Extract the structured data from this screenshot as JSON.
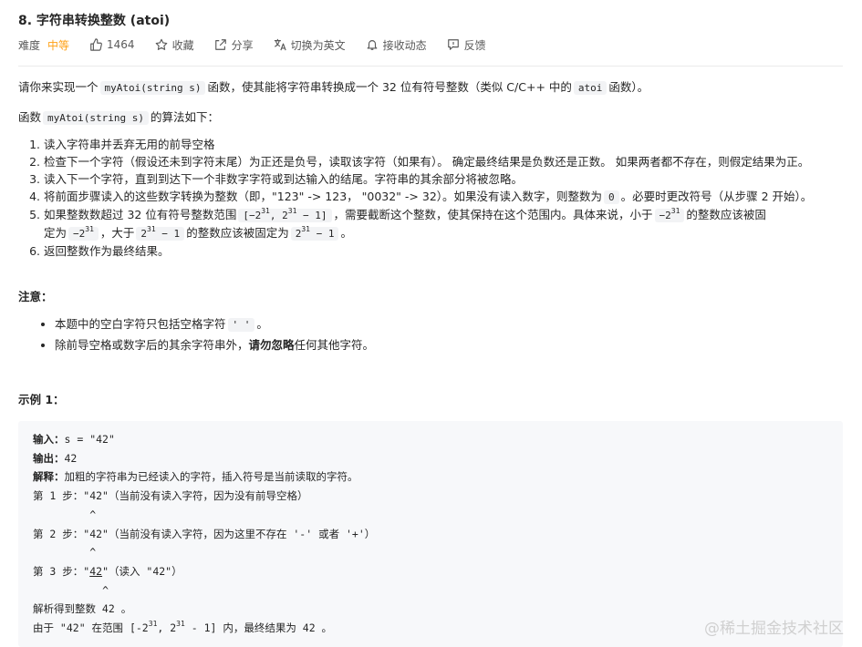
{
  "problem": {
    "title": "8. 字符串转换整数 (atoi)",
    "difficulty_label": "难度",
    "difficulty_value": "中等",
    "like_count": "1464",
    "favorite_label": "收藏",
    "share_label": "分享",
    "translate_label": "切换为英文",
    "subscribe_label": "接收动态",
    "feedback_label": "反馈"
  },
  "intro": {
    "p1_a": "请你来实现一个",
    "p1_code1": "myAtoi(string s)",
    "p1_b": "函数，使其能将字符串转换成一个 32 位有符号整数（类似 C/C++ 中的",
    "p1_code2": "atoi",
    "p1_c": "函数）。",
    "p2_a": "函数",
    "p2_code": "myAtoi(string s)",
    "p2_b": "的算法如下："
  },
  "steps": {
    "s1": "读入字符串并丢弃无用的前导空格",
    "s2": "检查下一个字符（假设还未到字符末尾）为正还是负号，读取该字符（如果有）。 确定最终结果是负数还是正数。 如果两者都不存在，则假定结果为正。",
    "s3": "读入下一个字符，直到到达下一个非数字字符或到达输入的结尾。字符串的其余部分将被忽略。",
    "s4_a": "将前面步骤读入的这些数字转换为整数（即，\"123\" -> 123， \"0032\" -> 32）。如果没有读入数字，则整数为",
    "s4_code": "0",
    "s4_b": "。必要时更改符号（从步骤 2 开始）。",
    "s5_a": "如果整数数超过 32 位有符号整数范围",
    "s5_code1_a": "[−2",
    "s5_code1_b": "31",
    "s5_code1_c": ",  2",
    "s5_code1_d": "31",
    "s5_code1_e": " − 1]",
    "s5_b": "，需要截断这个整数，使其保持在这个范围内。具体来说，小于",
    "s5_code2_a": "−2",
    "s5_code2_b": "31",
    "s5_c": "的整数应该被固",
    "s5_d": "定为",
    "s5_code3_a": "−2",
    "s5_code3_b": "31",
    "s5_e": "，大于",
    "s5_code4_a": "2",
    "s5_code4_b": "31",
    "s5_code4_c": " − 1",
    "s5_f": "的整数应该被固定为",
    "s5_code5_a": "2",
    "s5_code5_b": "31",
    "s5_code5_c": " − 1",
    "s5_g": "。",
    "s6": "返回整数作为最终结果。"
  },
  "notes": {
    "heading": "注意：",
    "n1_a": "本题中的空白字符只包括空格字符",
    "n1_b": "' '",
    "n1_c": "。",
    "n2_a": "除前导空格或数字后的其余字符串外，",
    "n2_b": "请勿忽略",
    "n2_c": "任何其他字符。"
  },
  "example": {
    "heading": "示例 1：",
    "input_label": "输入：",
    "input_value": "s = \"42\"",
    "output_label": "输出：",
    "output_value": "42",
    "explain_label": "解释：",
    "explain_value": "加粗的字符串为已经读入的字符，插入符号是当前读取的字符。",
    "step1": "第 1 步：\"42\"（当前没有读入字符，因为没有前导空格）",
    "caret1": "         ^",
    "step2": "第 2 步：\"42\"（当前没有读入字符，因为这里不存在 '-' 或者 '+'）",
    "caret2": "         ^",
    "step3_a": "第 3 步：\"",
    "step3_b": "42",
    "step3_c": "\"（读入 \"42\"）",
    "caret3": "           ^",
    "parsed": "解析得到整数 42 。",
    "range_a": "由于 \"42\" 在范围 [-2",
    "range_b": "31",
    "range_c": ", 2",
    "range_d": "31",
    "range_e": " - 1] 内，最终结果为 42 。"
  },
  "watermark": "@稀土掘金技术社区"
}
